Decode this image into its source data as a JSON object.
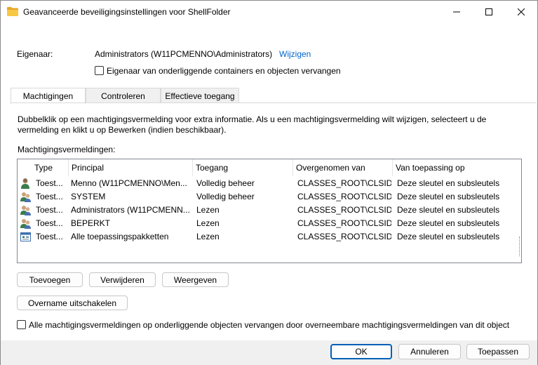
{
  "window": {
    "title": "Geavanceerde beveiligingsinstellingen voor ShellFolder"
  },
  "owner": {
    "label": "Eigenaar:",
    "value": "Administrators (W11PCMENNO\\Administrators)",
    "change_link": "Wijzigen",
    "replace_checkbox_label": "Eigenaar van onderliggende containers en objecten vervangen"
  },
  "tabs": [
    {
      "label": "Machtigingen"
    },
    {
      "label": "Controleren"
    },
    {
      "label": "Effectieve toegang"
    }
  ],
  "description": "Dubbelklik op een machtigingsvermelding voor extra informatie. Als u een machtigingsvermelding wilt wijzigen, selecteert u de vermelding en klikt u op Bewerken (indien beschikbaar).",
  "list": {
    "label": "Machtigingsvermeldingen:",
    "columns": [
      "Type",
      "Principal",
      "Toegang",
      "Overgenomen van",
      "Van toepassing op"
    ],
    "rows": [
      {
        "icon": "user-icon",
        "type": "Toest...",
        "principal": "Menno (W11PCMENNO\\Men...",
        "access": "Volledig beheer",
        "inherited": "CLASSES_ROOT\\CLSID",
        "applies": "Deze sleutel en subsleutels"
      },
      {
        "icon": "group-icon",
        "type": "Toest...",
        "principal": "SYSTEM",
        "access": "Volledig beheer",
        "inherited": "CLASSES_ROOT\\CLSID",
        "applies": "Deze sleutel en subsleutels"
      },
      {
        "icon": "group-icon",
        "type": "Toest...",
        "principal": "Administrators (W11PCMENN...",
        "access": "Lezen",
        "inherited": "CLASSES_ROOT\\CLSID",
        "applies": "Deze sleutel en subsleutels"
      },
      {
        "icon": "group-icon",
        "type": "Toest...",
        "principal": "BEPERKT",
        "access": "Lezen",
        "inherited": "CLASSES_ROOT\\CLSID",
        "applies": "Deze sleutel en subsleutels"
      },
      {
        "icon": "app-package-icon",
        "type": "Toest...",
        "principal": "Alle toepassingspakketten",
        "access": "Lezen",
        "inherited": "CLASSES_ROOT\\CLSID",
        "applies": "Deze sleutel en subsleutels"
      }
    ]
  },
  "buttons": {
    "add": "Toevoegen",
    "remove": "Verwijderen",
    "view": "Weergeven",
    "disable_inheritance": "Overname uitschakelen"
  },
  "replace_all_checkbox_label": "Alle machtigingsvermeldingen op onderliggende objecten vervangen door overneembare machtigingsvermeldingen van dit object",
  "dialog_buttons": {
    "ok": "OK",
    "cancel": "Annuleren",
    "apply": "Toepassen"
  },
  "colors": {
    "link": "#0066cc",
    "primary_border": "#005fb8"
  }
}
